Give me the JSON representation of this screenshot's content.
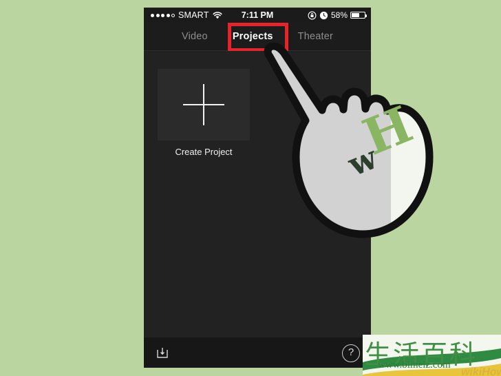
{
  "background": {
    "color": "#bbd5a0"
  },
  "status_bar": {
    "signal_filled": 4,
    "signal_empty": 1,
    "carrier": "SMART",
    "wifi_icon": "wifi-icon",
    "time": "7:11 PM",
    "rotation_lock_icon": "rotation-lock-icon",
    "alarm_icon": "alarm-clock-icon",
    "battery_percent": "58%",
    "battery_level": 58
  },
  "tab_bar": {
    "tabs": [
      {
        "label": "Video",
        "active": false
      },
      {
        "label": "Projects",
        "active": true
      },
      {
        "label": "Theater",
        "active": false
      }
    ],
    "highlight_color": "#e8232a",
    "highlighted_tab": "Projects"
  },
  "content": {
    "create_project": {
      "label": "Create Project",
      "icon": "plus-icon"
    }
  },
  "bottom_bar": {
    "import_icon": "import-download-icon",
    "help_icon": "help-question-icon",
    "help_label": "?"
  },
  "cursor": {
    "type": "pointing-hand-cursor",
    "logo": "wH"
  },
  "watermark": {
    "title_cn": "生活百科",
    "url": "www.bimeiz.com",
    "brand": "wikiHow"
  }
}
